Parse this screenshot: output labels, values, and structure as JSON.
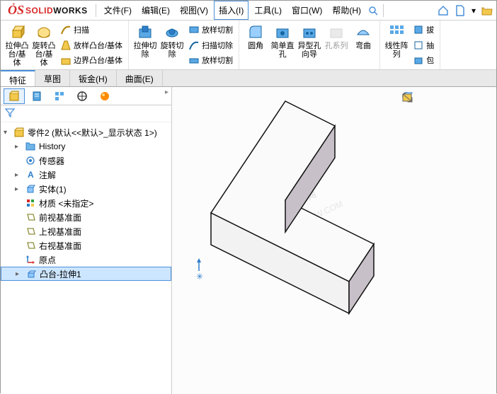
{
  "brand": {
    "prefix": "SOLID",
    "suffix": "WORKS"
  },
  "menu": {
    "file": "文件(F)",
    "edit": "编辑(E)",
    "view": "视图(V)",
    "insert": "插入(I)",
    "tools": "工具(L)",
    "window": "窗口(W)",
    "help": "帮助(H)"
  },
  "ribbon": {
    "extrude_boss": "拉伸凸台/基体",
    "revolve_boss": "旋转凸台/基体",
    "sweep": "扫描",
    "loft": "放样凸台/基体",
    "boundary": "边界凸台/基体",
    "extrude_cut": "拉伸切除",
    "revolve_cut": "旋转切除",
    "loft_cut": "放样切割",
    "sweep_cut": "扫描切除",
    "loft_cut2": "放样切割",
    "fillet": "圆角",
    "simple_hole": "简单直孔",
    "hole_wizard": "异型孔向导",
    "hole_series": "孔系列",
    "dome": "弯曲",
    "linear_pattern": "线性阵列",
    "shell_a": "拔",
    "shell_b": "抽",
    "shell_c": "包"
  },
  "tabs": {
    "features": "特征",
    "sketch": "草图",
    "sheet_metal": "钣金(H)",
    "surfaces": "曲面(E)"
  },
  "tree": {
    "root": "零件2 (默认<<默认>_显示状态 1>)",
    "history": "History",
    "sensors": "传感器",
    "annotations": "注解",
    "solid_bodies": "实体(1)",
    "material": "材质 <未指定>",
    "front_plane": "前视基准面",
    "top_plane": "上视基准面",
    "right_plane": "右视基准面",
    "origin": "原点",
    "boss_extrude": "凸台-拉伸1"
  },
  "watermark": {
    "line1": "软件自学网",
    "line2": "WWW.RJZXW.COM"
  }
}
